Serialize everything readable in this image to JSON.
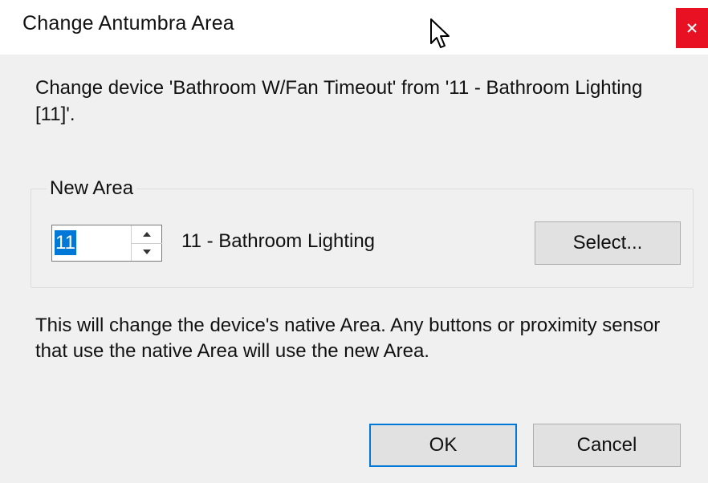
{
  "window": {
    "title": "Change Antumbra Area",
    "close_glyph": "×",
    "close_color": "#e81123"
  },
  "message": "Change device 'Bathroom W/Fan Timeout' from '11 - Bathroom Lighting [11]'.",
  "new_area": {
    "group_label": "New Area",
    "spinner_value": "11",
    "spinner_up_icon": "arrow-up-icon",
    "spinner_down_icon": "arrow-down-icon",
    "area_name": "11 - Bathroom Lighting",
    "select_label": "Select..."
  },
  "info": "This will change the device's native Area. Any buttons or proximity sensor that use the native Area will use the new Area.",
  "buttons": {
    "ok_label": "OK",
    "cancel_label": "Cancel"
  },
  "colors": {
    "selection": "#0078d7",
    "default_button_border": "#0078d7"
  }
}
